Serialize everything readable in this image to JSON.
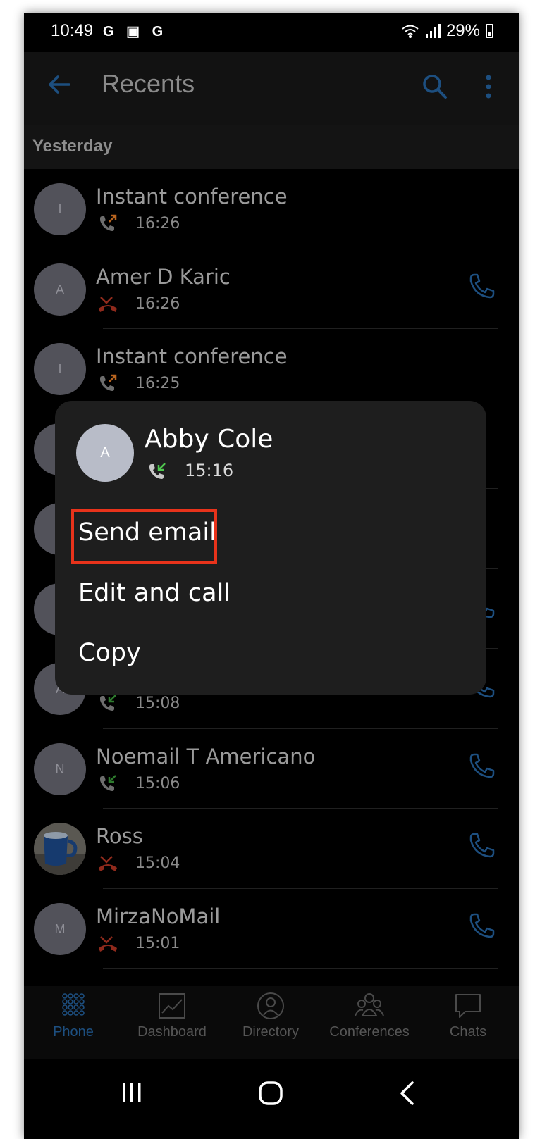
{
  "status_bar": {
    "time": "10:49",
    "notification_icons": "G ▣ G",
    "battery": "29%"
  },
  "app_bar": {
    "title": "Recents",
    "icons": [
      "back-arrow-icon",
      "search-icon",
      "more-vert-icon"
    ]
  },
  "section_header": "Yesterday",
  "recents": [
    {
      "initial": "I",
      "name": "Instant conference",
      "call_type": "outgoing",
      "time": "16:26",
      "has_call_button": false
    },
    {
      "initial": "A",
      "name": "Amer D Karic",
      "call_type": "missed",
      "time": "16:26",
      "has_call_button": true
    },
    {
      "initial": "I",
      "name": "Instant conference",
      "call_type": "outgoing",
      "time": "16:25",
      "has_call_button": false
    },
    {
      "initial": "",
      "name": "",
      "call_type": "",
      "time": "",
      "has_call_button": false
    },
    {
      "initial": "",
      "name": "",
      "call_type": "",
      "time": "",
      "has_call_button": false
    },
    {
      "initial": "",
      "name": "",
      "call_type": "",
      "time": "",
      "has_call_button": true
    },
    {
      "initial": "A",
      "name": "",
      "call_type": "incoming",
      "time": "15:08",
      "has_call_button": true
    },
    {
      "initial": "N",
      "name": "Noemail T Americano",
      "call_type": "incoming",
      "time": "15:06",
      "has_call_button": true
    },
    {
      "initial": "",
      "name": "Ross",
      "call_type": "missed",
      "time": "15:04",
      "has_call_button": true,
      "photo": "mug"
    },
    {
      "initial": "M",
      "name": "MirzaNoMail",
      "call_type": "missed",
      "time": "15:01",
      "has_call_button": true
    }
  ],
  "context_sheet": {
    "contact_initial": "A",
    "contact_name": "Abby Cole",
    "call_type": "incoming",
    "time": "15:16",
    "actions": [
      "Send email",
      "Edit and call",
      "Copy"
    ],
    "highlighted_action": "Send email"
  },
  "bottom_nav": [
    {
      "label": "Phone",
      "icon": "dialpad-icon",
      "active": true
    },
    {
      "label": "Dashboard",
      "icon": "chart-icon",
      "active": false
    },
    {
      "label": "Directory",
      "icon": "person-icon",
      "active": false
    },
    {
      "label": "Conferences",
      "icon": "group-icon",
      "active": false
    },
    {
      "label": "Chats",
      "icon": "chat-bubble-icon",
      "active": false
    }
  ],
  "colors": {
    "accent": "#1d4f80",
    "missed": "#8f2a1c",
    "incoming": "#2d7a2d",
    "outgoing": "#b8641f",
    "highlight_box": "#e8331b"
  }
}
